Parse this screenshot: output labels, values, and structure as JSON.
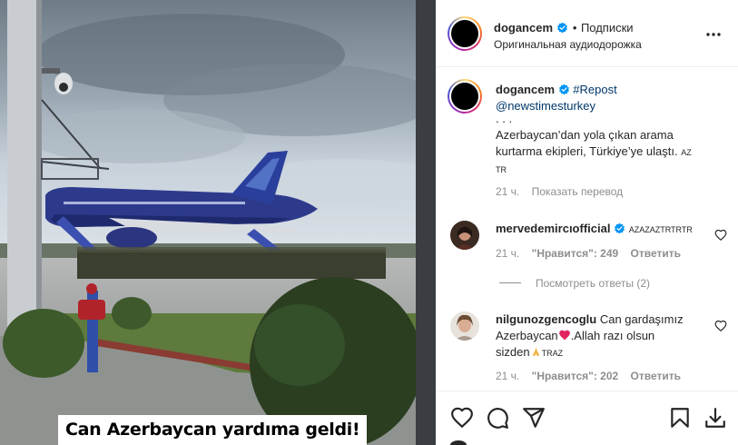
{
  "post": {
    "author": "dogancem",
    "separator": "•",
    "follow_label": "Подписки",
    "audio": "Оригинальная аудиодорожка",
    "more_icon": "more-horizontal-icon"
  },
  "video": {
    "caption": "Can Azerbaycan yardıma geldi!"
  },
  "caption": {
    "author": "dogancem",
    "hashtag": "#Repost",
    "mention": "@newstimesturkey",
    "dots": ". . .",
    "text_line1": "Azerbaycan’dan yola çıkan arama",
    "text_line2": "kurtarma ekipleri, Türkiye’ye ulaştı.",
    "flag1": "AZ",
    "flag2": "TR",
    "time": "21 ч.",
    "translate_label": "Показать перевод"
  },
  "comments": [
    {
      "username": "mervedemircıofficial",
      "flags": "AZAZAZTRTRTR",
      "time": "21 ч.",
      "likes": "\"Нравится\": 249",
      "reply_label": "Ответить"
    },
    {
      "username": "nilgunozgencoglu",
      "text_part1": "Can gardaşımız",
      "text_part2": "Azerbaycan",
      "text_part3": ".Allah razı olsun",
      "text_part4": "sizden",
      "flags": "TRAZ",
      "time": "21 ч.",
      "likes": "\"Нравится\": 202",
      "reply_label": "Ответить"
    }
  ],
  "view_replies_label": "Посмотреть ответы (2)",
  "actions": [
    "heart-icon",
    "comment-icon",
    "share-icon",
    "bookmark-icon",
    "download-icon"
  ],
  "colors": {
    "verified": "#0095f6",
    "link": "#00376b",
    "secondary_text": "#8e8e8e",
    "plane_body": "#2d3a8c"
  }
}
